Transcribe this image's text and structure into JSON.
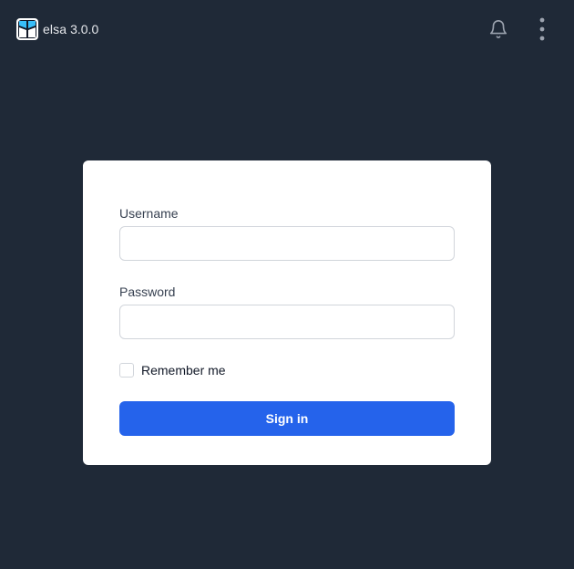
{
  "header": {
    "logo_icon": "elsa-logo-icon",
    "app_name": "elsa",
    "version": "3.0.0",
    "notifications_icon": "bell-icon",
    "menu_icon": "vertical-dots-icon"
  },
  "login": {
    "username_label": "Username",
    "username_value": "",
    "password_label": "Password",
    "password_value": "",
    "remember_label": "Remember me",
    "remember_checked": false,
    "submit_label": "Sign in"
  },
  "colors": {
    "background": "#1f2937",
    "card": "#ffffff",
    "primary": "#2563eb",
    "logo_blue": "#38bdf8"
  }
}
